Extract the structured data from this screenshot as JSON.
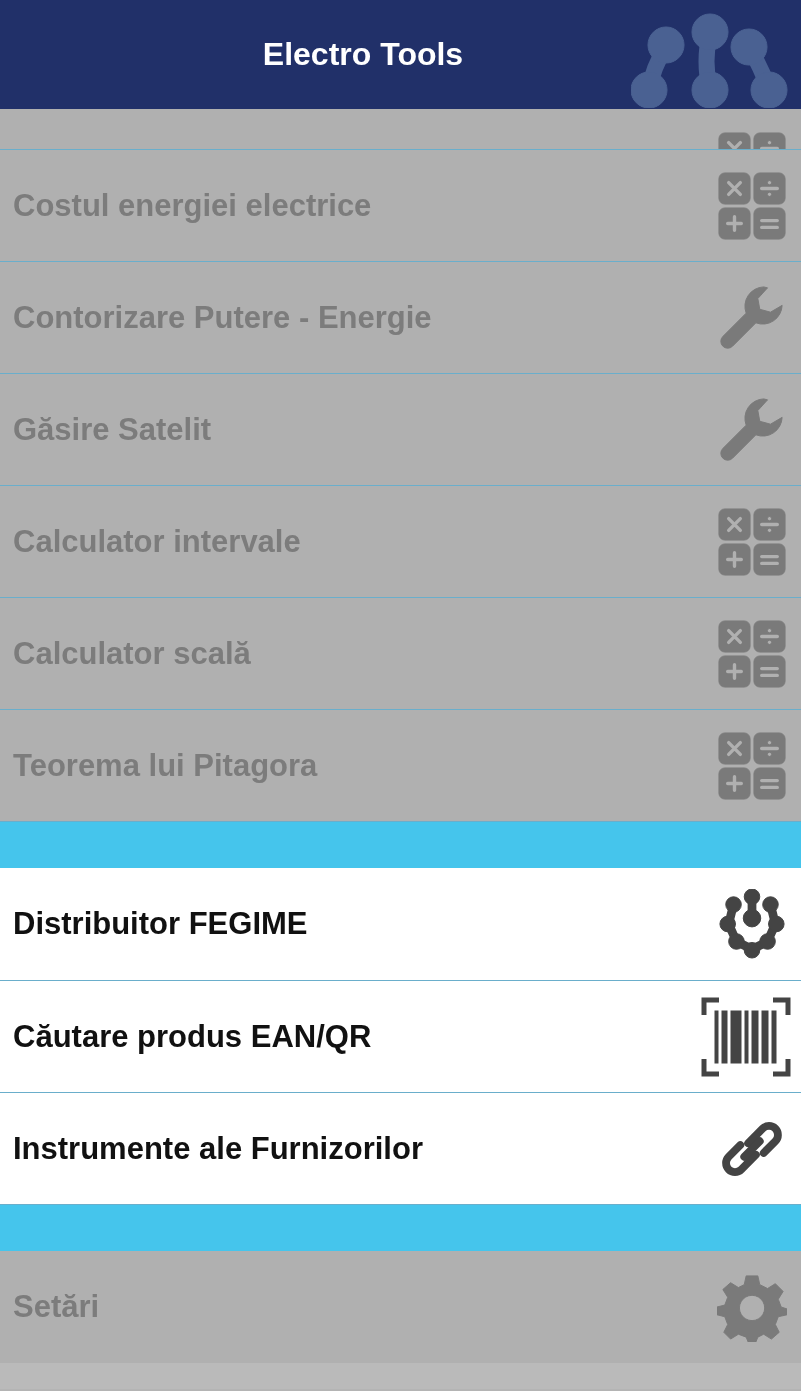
{
  "header": {
    "title": "Electro Tools"
  },
  "sections": [
    {
      "items": [
        {
          "kind": "calculator",
          "disabled": true,
          "partial": true
        },
        {
          "label": "Costul energiei electrice",
          "kind": "calculator",
          "disabled": true
        },
        {
          "label": "Contorizare Putere - Energie",
          "kind": "wrench",
          "disabled": true
        },
        {
          "label": "Găsire Satelit",
          "kind": "wrench",
          "disabled": true
        },
        {
          "label": "Calculator intervale",
          "kind": "calculator",
          "disabled": true
        },
        {
          "label": "Calculator scală",
          "kind": "calculator",
          "disabled": true
        },
        {
          "label": "Teorema lui Pitagora",
          "kind": "calculator",
          "disabled": true
        }
      ]
    },
    {
      "items": [
        {
          "label": "Distribuitor FEGIME",
          "kind": "network",
          "disabled": false
        },
        {
          "label": "Căutare produs EAN/QR",
          "kind": "barcode",
          "disabled": false
        },
        {
          "label": "Instrumente ale Furnizorilor",
          "kind": "link",
          "disabled": false
        }
      ]
    },
    {
      "items": [
        {
          "label": "Setări",
          "kind": "gear",
          "disabled": true
        }
      ]
    }
  ]
}
